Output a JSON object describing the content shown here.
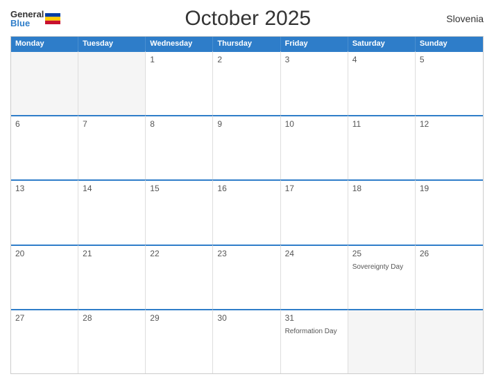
{
  "header": {
    "logo_general": "General",
    "logo_blue": "Blue",
    "title": "October 2025",
    "country": "Slovenia"
  },
  "days": [
    "Monday",
    "Tuesday",
    "Wednesday",
    "Thursday",
    "Friday",
    "Saturday",
    "Sunday"
  ],
  "weeks": [
    [
      {
        "date": "",
        "event": "",
        "empty": true
      },
      {
        "date": "",
        "event": "",
        "empty": true
      },
      {
        "date": "1",
        "event": ""
      },
      {
        "date": "2",
        "event": ""
      },
      {
        "date": "3",
        "event": ""
      },
      {
        "date": "4",
        "event": ""
      },
      {
        "date": "5",
        "event": ""
      }
    ],
    [
      {
        "date": "6",
        "event": ""
      },
      {
        "date": "7",
        "event": ""
      },
      {
        "date": "8",
        "event": ""
      },
      {
        "date": "9",
        "event": ""
      },
      {
        "date": "10",
        "event": ""
      },
      {
        "date": "11",
        "event": ""
      },
      {
        "date": "12",
        "event": ""
      }
    ],
    [
      {
        "date": "13",
        "event": ""
      },
      {
        "date": "14",
        "event": ""
      },
      {
        "date": "15",
        "event": ""
      },
      {
        "date": "16",
        "event": ""
      },
      {
        "date": "17",
        "event": ""
      },
      {
        "date": "18",
        "event": ""
      },
      {
        "date": "19",
        "event": ""
      }
    ],
    [
      {
        "date": "20",
        "event": ""
      },
      {
        "date": "21",
        "event": ""
      },
      {
        "date": "22",
        "event": ""
      },
      {
        "date": "23",
        "event": ""
      },
      {
        "date": "24",
        "event": ""
      },
      {
        "date": "25",
        "event": "Sovereignty Day"
      },
      {
        "date": "26",
        "event": ""
      }
    ],
    [
      {
        "date": "27",
        "event": ""
      },
      {
        "date": "28",
        "event": ""
      },
      {
        "date": "29",
        "event": ""
      },
      {
        "date": "30",
        "event": ""
      },
      {
        "date": "31",
        "event": "Reformation Day"
      },
      {
        "date": "",
        "event": "",
        "empty": true
      },
      {
        "date": "",
        "event": "",
        "empty": true
      }
    ]
  ]
}
